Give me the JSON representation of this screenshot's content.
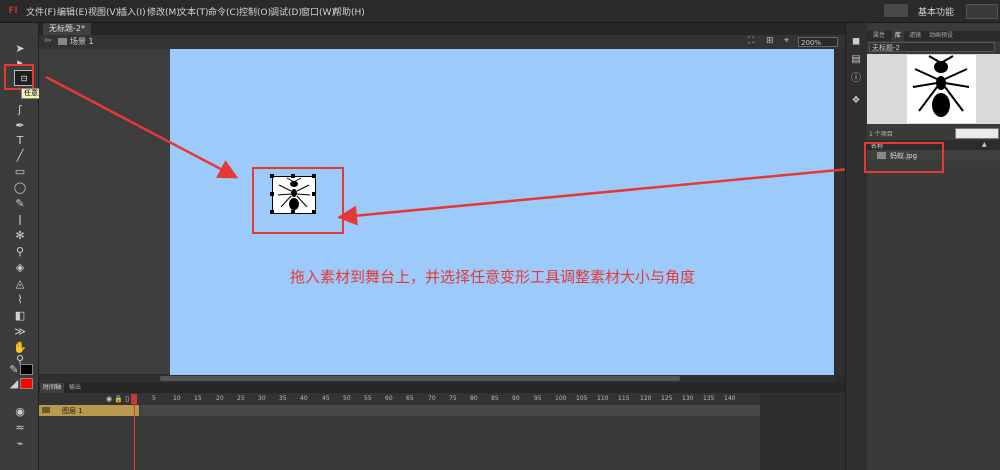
{
  "app": {
    "logo": "Fl"
  },
  "menu": [
    "文件(F)",
    "编辑(E)",
    "视图(V)",
    "插入(I)",
    "修改(M)",
    "文本(T)",
    "命令(C)",
    "控制(O)",
    "调试(D)",
    "窗口(W)",
    "帮助(H)"
  ],
  "workspace": {
    "label": "基本功能"
  },
  "document": {
    "tab": "无标题-2*",
    "scene": "场景 1",
    "zoom": "200%"
  },
  "toolbar": {
    "tooltip": "任意变形工具(Q)",
    "transform_glyph": "⊡"
  },
  "colors": {
    "stroke": "#000000",
    "fill": "#ff0000",
    "stage": "#9ccbfb",
    "annotation": "#e53935"
  },
  "stage": {
    "instruction": "拖入素材到舞台上，并选择任意变形工具调整素材大小与角度"
  },
  "timeline": {
    "tabs": [
      "时间轴",
      "输出"
    ],
    "layer_name": "图层 1",
    "frame_numbers": [
      "1",
      "5",
      "10",
      "15",
      "20",
      "25",
      "30",
      "35",
      "40",
      "45",
      "50",
      "55",
      "60",
      "65",
      "70",
      "75",
      "80",
      "85",
      "90",
      "95",
      "100",
      "105",
      "110",
      "115",
      "120",
      "125",
      "130",
      "135",
      "140"
    ]
  },
  "library": {
    "tabs": [
      "属性",
      "库",
      "滤镜",
      "动画预设"
    ],
    "document": "无标题-2",
    "count": "1 个项目",
    "header_name": "名称",
    "item": "蚂蚁.jpg"
  }
}
